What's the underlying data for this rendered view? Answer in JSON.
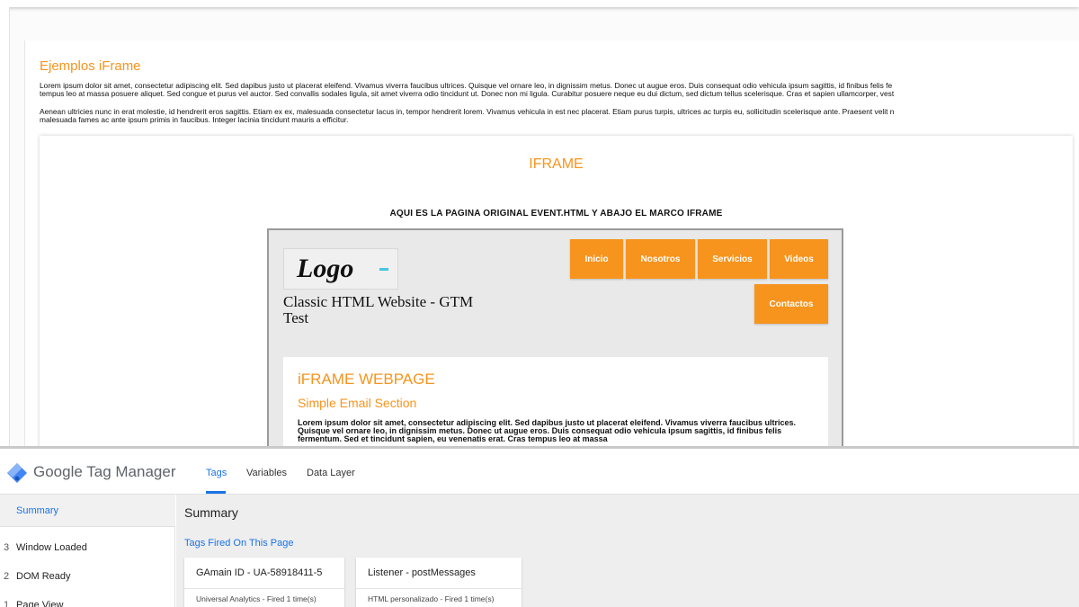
{
  "page": {
    "section_title": "Ejemplos iFrame",
    "paragraph1_line1": "Lorem ipsum dolor sit amet, consectetur adipiscing elit. Sed dapibus justo ut placerat eleifend. Vivamus viverra faucibus ultrices. Quisque vel ornare leo, in dignissim metus. Donec ut augue eros. Duis consequat odio vehicula ipsum sagittis, id finibus felis fe",
    "paragraph1_line2": "tempus leo at massa posuere aliquet. Sed congue et purus vel auctor. Sed convallis sodales ligula, sit amet viverra odio tincidunt ut. Donec non mi ligula. Curabitur posuere neque eu dui dictum, sed dictum tellus scelerisque. Cras et sapien ullamcorper, vest",
    "paragraph2_line1": "Aenean ultricies nunc in erat molestie, id hendrerit eros sagittis. Etiam ex ex, malesuada consectetur lacus in, tempor hendrerit lorem. Vivamus vehicula in est nec placerat. Etiam purus turpis, ultrices ac turpis eu, sollicitudin scelerisque ante. Praesent velit n",
    "paragraph2_line2": "malesuada fames ac ante ipsum primis in faucibus. Integer lacinia tincidunt mauris a efficitur.",
    "iframe_heading": "IFRAME",
    "iframe_note": "AQUI ES LA PAGINA ORIGINAL EVENT.HTML Y ABAJO EL MARCO IFRAME"
  },
  "site": {
    "logo_text": "Logo",
    "title": "Classic HTML Website - GTM Test",
    "nav": {
      "inicio": "Inicio",
      "nosotros": "Nosotros",
      "servicios": "Servicios",
      "videos": "Videos",
      "contactos": "Contactos"
    },
    "content_title": "iFRAME WEBPAGE",
    "content_subtitle": "Simple Email Section",
    "content_text": "Lorem ipsum dolor sit amet, consectetur adipiscing elit. Sed dapibus justo ut placerat eleifend. Vivamus viverra faucibus ultrices. Quisque vel ornare leo, in dignissim metus. Donec ut augue eros. Duis consequat odio vehicula ipsum sagittis, id finibus felis fermentum. Sed et tincidunt sapien, eu venenatis erat. Cras tempus leo at massa"
  },
  "gtm": {
    "brand_google": "Google",
    "brand_product": "Tag Manager",
    "tabs": {
      "tags": "Tags",
      "variables": "Variables",
      "data_layer": "Data Layer"
    },
    "sidebar": {
      "summary": "Summary",
      "items": [
        {
          "num": "3",
          "label": "Window Loaded"
        },
        {
          "num": "2",
          "label": "DOM Ready"
        },
        {
          "num": "1",
          "label": "Page View"
        }
      ]
    },
    "main": {
      "title": "Summary",
      "subtitle": "Tags Fired On This Page",
      "cards": [
        {
          "name": "GAmain ID - UA-58918411-5",
          "meta": "Universal Analytics - Fired 1 time(s)"
        },
        {
          "name": "Listener - postMessages",
          "meta": "HTML personalizado - Fired 1 time(s)"
        }
      ]
    },
    "colors": {
      "accent_blue": "#1a73e8",
      "orange": "#f7941d"
    }
  }
}
